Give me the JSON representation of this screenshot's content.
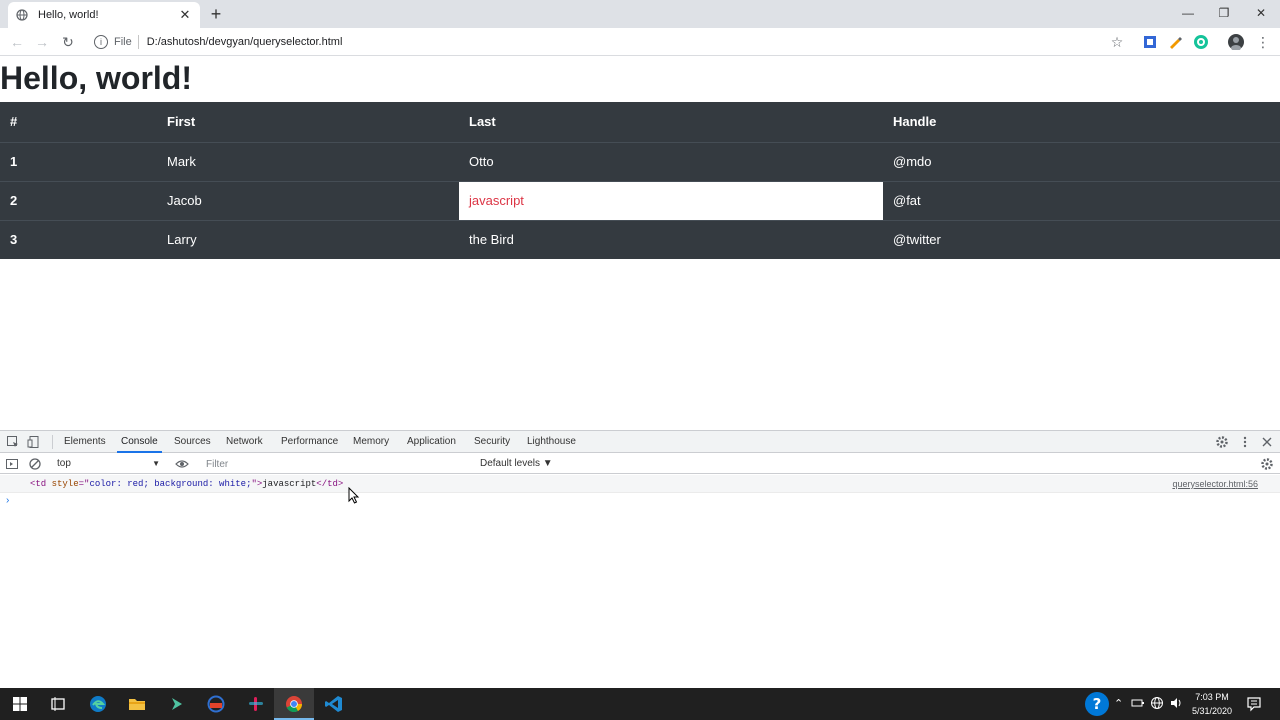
{
  "browser": {
    "tab_title": "Hello, world!",
    "tab_close": "✕",
    "new_tab": "+",
    "minimize": "—",
    "restore": "❐",
    "close": "✕",
    "back": "←",
    "forward": "→",
    "reload": "↻",
    "info_symbol": "i",
    "file_label": "File",
    "url": "D:/ashutosh/devgyan/queryselector.html",
    "star": "☆",
    "menu": "⋮"
  },
  "page": {
    "title": "Hello, world!",
    "table": {
      "headers": [
        "#",
        "First",
        "Last",
        "Handle"
      ],
      "rows": [
        [
          "1",
          "Mark",
          "Otto",
          "@mdo"
        ],
        [
          "2",
          "Jacob",
          "javascript",
          "@fat"
        ],
        [
          "3",
          "Larry",
          "the Bird",
          "@twitter"
        ]
      ],
      "highlight_color": "#dc3545"
    }
  },
  "devtools": {
    "tabs": [
      "Elements",
      "Console",
      "Sources",
      "Network",
      "Performance",
      "Memory",
      "Application",
      "Security",
      "Lighthouse"
    ],
    "active_tab": "Console",
    "context": "top",
    "filter_placeholder": "Filter",
    "levels": "Default levels ▼",
    "log": {
      "open": "<td ",
      "attr_name": "style",
      "eq": "=\"",
      "attr_value": "color: red; background: white;",
      "close_q": "\">",
      "text": "javascript",
      "end": "</td>",
      "source": "queryselector.html:56"
    },
    "prompt": "›"
  },
  "taskbar": {
    "time": "7:03 PM",
    "date": "5/31/2020"
  }
}
